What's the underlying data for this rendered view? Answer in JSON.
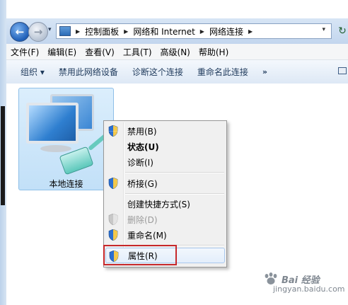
{
  "address": {
    "back_glyph": "←",
    "forward_glyph": "→",
    "recent_glyph": "▾",
    "crumbs": [
      "控制面板",
      "网络和 Internet",
      "网络连接"
    ],
    "sep_glyph": "▶",
    "dropdown_glyph": "▾",
    "refresh_glyph": "↻"
  },
  "menubar": {
    "items": [
      "文件(F)",
      "编辑(E)",
      "查看(V)",
      "工具(T)",
      "高级(N)",
      "帮助(H)"
    ]
  },
  "commandbar": {
    "organize": "组织 ▾",
    "disable_device": "禁用此网络设备",
    "diagnose": "诊断这个连接",
    "rename": "重命名此连接",
    "more": "»"
  },
  "connection": {
    "label": "本地连接"
  },
  "context_menu": {
    "items": [
      {
        "label": "禁用(B)",
        "shield": true,
        "bold": false,
        "disabled": false
      },
      {
        "label": "状态(U)",
        "shield": false,
        "bold": true,
        "disabled": false
      },
      {
        "label": "诊断(I)",
        "shield": false,
        "bold": false,
        "disabled": false
      },
      {
        "label": "桥接(G)",
        "shield": true,
        "bold": false,
        "disabled": false
      },
      {
        "label": "创建快捷方式(S)",
        "shield": false,
        "bold": false,
        "disabled": false
      },
      {
        "label": "删除(D)",
        "shield": true,
        "bold": false,
        "disabled": true
      },
      {
        "label": "重命名(M)",
        "shield": true,
        "bold": false,
        "disabled": false
      },
      {
        "label": "属性(R)",
        "shield": true,
        "bold": false,
        "disabled": false
      }
    ],
    "highlight_color": "#c6282b"
  },
  "watermark": {
    "text": "Bai 经验",
    "sub": "jingyan.baidu.com"
  }
}
